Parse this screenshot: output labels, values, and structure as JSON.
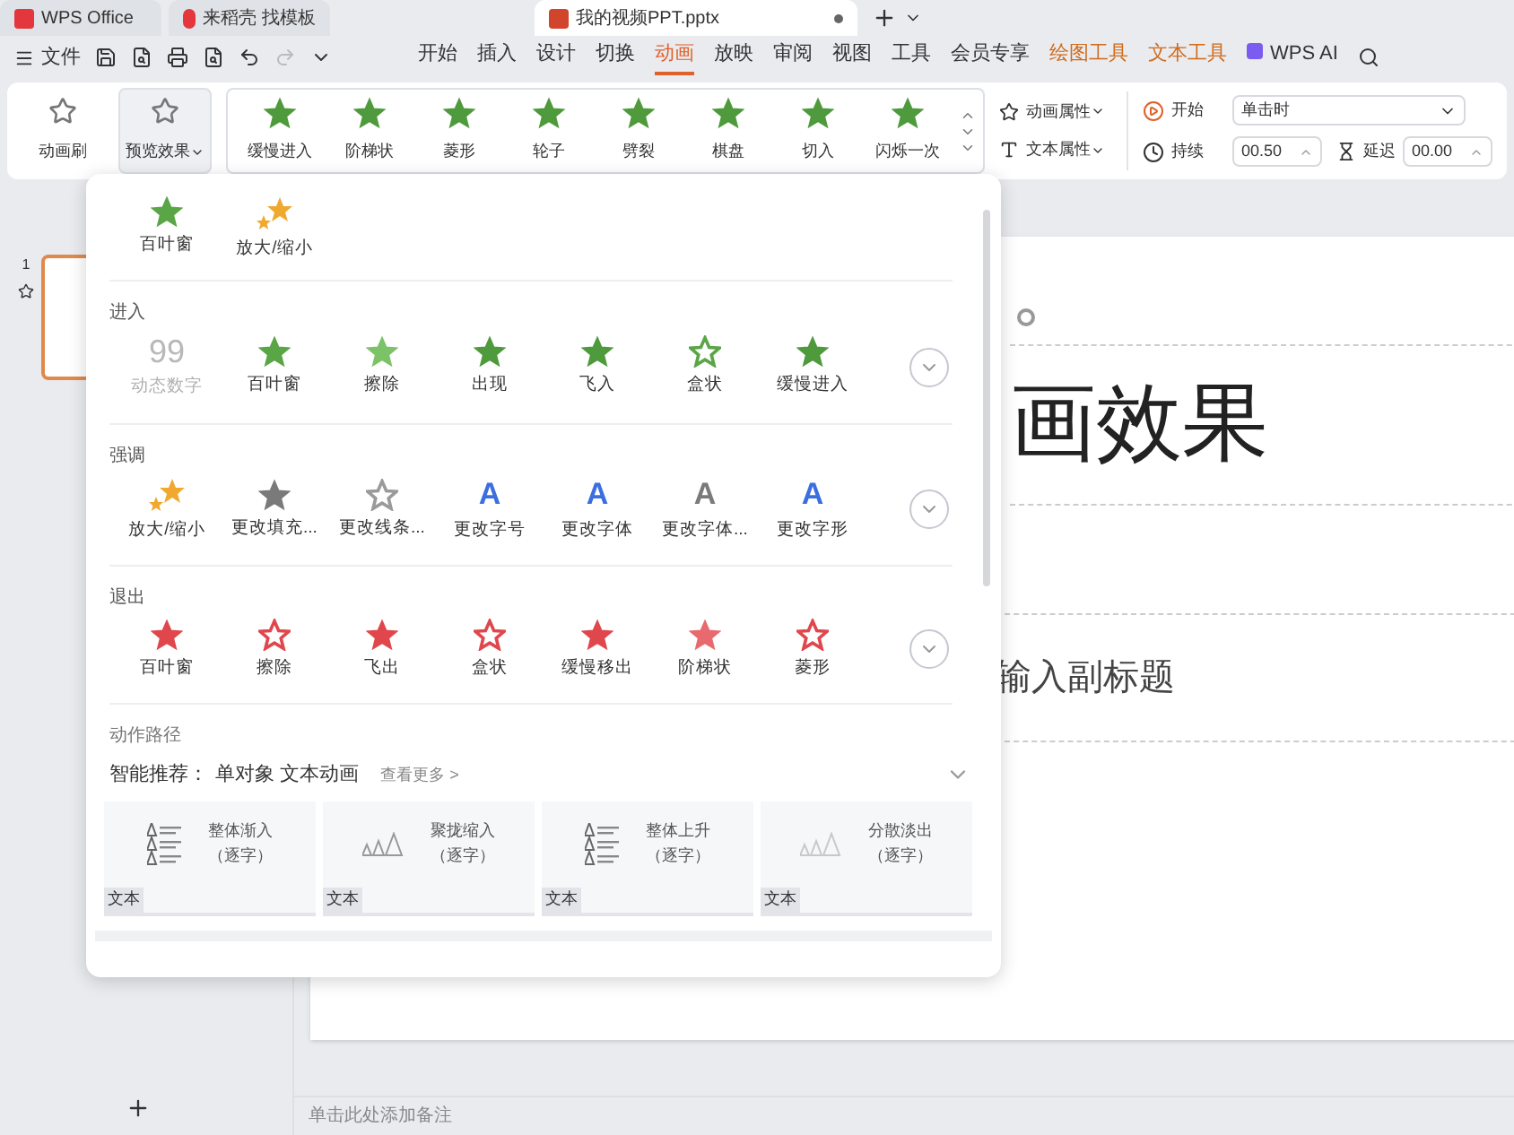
{
  "tabs": [
    {
      "label": "WPS Office",
      "kind": "home",
      "selected": false
    },
    {
      "label": "来稻壳 找模板",
      "kind": "template",
      "selected": false
    },
    {
      "label": "我的视频PPT.pptx",
      "kind": "doc",
      "selected": true
    }
  ],
  "menu": {
    "file": "文件",
    "tabs": [
      {
        "label": "开始",
        "kind": "main",
        "selected": false
      },
      {
        "label": "插入",
        "kind": "main",
        "selected": false
      },
      {
        "label": "设计",
        "kind": "main",
        "selected": false
      },
      {
        "label": "切换",
        "kind": "main",
        "selected": false
      },
      {
        "label": "动画",
        "kind": "main",
        "selected": true
      },
      {
        "label": "放映",
        "kind": "main",
        "selected": false
      },
      {
        "label": "审阅",
        "kind": "main",
        "selected": false
      },
      {
        "label": "视图",
        "kind": "main",
        "selected": false
      },
      {
        "label": "工具",
        "kind": "main",
        "selected": false
      },
      {
        "label": "会员专享",
        "kind": "main",
        "selected": false
      },
      {
        "label": "绘图工具",
        "kind": "context",
        "selected": false
      },
      {
        "label": "文本工具",
        "kind": "context",
        "selected": false
      },
      {
        "label": "WPS AI",
        "kind": "ai",
        "selected": false
      }
    ]
  },
  "ribbon": {
    "brush": "动画刷",
    "preview": {
      "label": "预览效果",
      "expanded": true
    },
    "gallery": [
      "缓慢进入",
      "阶梯状",
      "菱形",
      "轮子",
      "劈裂",
      "棋盘",
      "切入",
      "闪烁一次"
    ],
    "properties": [
      "动画属性",
      "文本属性"
    ],
    "timing": {
      "start_label": "开始",
      "start_value": "单击时",
      "duration_label": "持续",
      "duration_value": "00.50",
      "delay_label": "延迟",
      "delay_value": "00.00"
    }
  },
  "popup": {
    "recent": [
      {
        "label": "百叶窗",
        "kind": "star",
        "color": "#5aa546"
      },
      {
        "label": "放大/缩小",
        "kind": "sparkle",
        "color": "#f0a92e"
      }
    ],
    "sections": [
      {
        "title": "进入",
        "items": [
          {
            "label": "动态数字",
            "kind": "digits",
            "glyph": "99",
            "color": "#b8b8b8",
            "disabled": true
          },
          {
            "label": "百叶窗",
            "kind": "star",
            "color": "#5aa546",
            "disabled": false
          },
          {
            "label": "擦除",
            "kind": "star",
            "color": "#7cc267",
            "disabled": false
          },
          {
            "label": "出现",
            "kind": "star",
            "color": "#4e9a3c",
            "disabled": false
          },
          {
            "label": "飞入",
            "kind": "star",
            "color": "#4e9a3c",
            "disabled": false
          },
          {
            "label": "盒状",
            "kind": "outline",
            "color": "#5aa546",
            "disabled": false
          },
          {
            "label": "缓慢进入",
            "kind": "star",
            "color": "#4e9a3c",
            "disabled": false
          }
        ]
      },
      {
        "title": "强调",
        "items": [
          {
            "label": "放大/缩小",
            "kind": "sparkle",
            "color": "#f0a92e"
          },
          {
            "label": "更改填充...",
            "kind": "star",
            "color": "#7a7a7a"
          },
          {
            "label": "更改线条...",
            "kind": "outline",
            "color": "#9a9a9a"
          },
          {
            "label": "更改字号",
            "kind": "letter",
            "glyph": "A",
            "color": "#3b6fe0"
          },
          {
            "label": "更改字体",
            "kind": "letter",
            "glyph": "A",
            "color": "#3b6fe0"
          },
          {
            "label": "更改字体...",
            "kind": "letter",
            "glyph": "A",
            "color": "#7a7a7a"
          },
          {
            "label": "更改字形",
            "kind": "letter",
            "glyph": "A",
            "color": "#3b6fe0"
          }
        ]
      },
      {
        "title": "退出",
        "items": [
          {
            "label": "百叶窗",
            "kind": "star",
            "color": "#e0474c"
          },
          {
            "label": "擦除",
            "kind": "outline",
            "color": "#e0474c"
          },
          {
            "label": "飞出",
            "kind": "star",
            "color": "#e0474c"
          },
          {
            "label": "盒状",
            "kind": "outline",
            "color": "#e0474c"
          },
          {
            "label": "缓慢移出",
            "kind": "star",
            "color": "#e0474c"
          },
          {
            "label": "阶梯状",
            "kind": "star",
            "color": "#e86a6e"
          },
          {
            "label": "菱形",
            "kind": "outline",
            "color": "#e0474c"
          }
        ]
      }
    ],
    "path_title": "动作路径",
    "smart": {
      "label": "智能推荐：",
      "tags": "单对象 文本动画",
      "more": "查看更多 >"
    },
    "cards": [
      {
        "name": "整体渐入",
        "sub": "（逐字）",
        "kind": "lines",
        "tag": "文本"
      },
      {
        "name": "聚拢缩入",
        "sub": "（逐字）",
        "kind": "letters",
        "tag": "文本"
      },
      {
        "name": "整体上升",
        "sub": "（逐字）",
        "kind": "lines",
        "tag": "文本"
      },
      {
        "name": "分散淡出",
        "sub": "（逐字）",
        "kind": "faded",
        "tag": "文本"
      }
    ]
  },
  "slides": [
    {
      "number": "1",
      "selected": true
    }
  ],
  "slide": {
    "title": "画效果",
    "subtitle": "输入副标题"
  },
  "notes": "单击此处添加备注"
}
